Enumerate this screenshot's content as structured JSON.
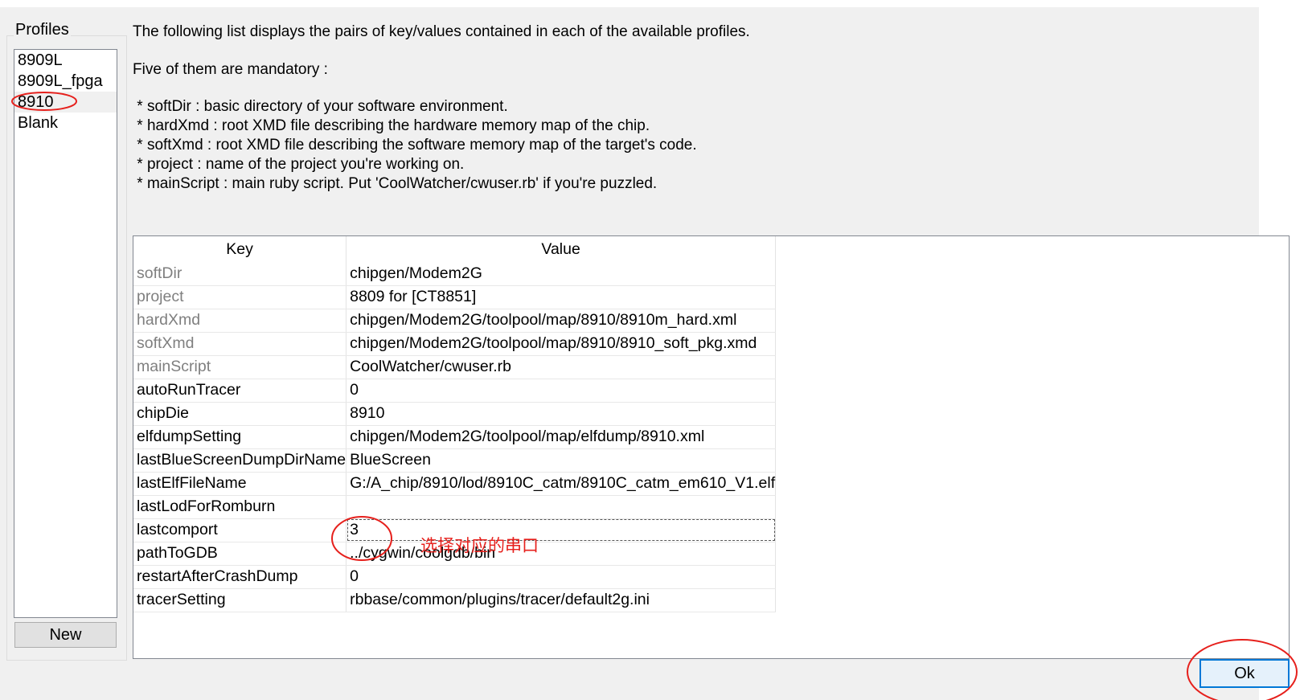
{
  "profiles": {
    "title": "Profiles",
    "items": [
      {
        "label": "8909L"
      },
      {
        "label": "8909L_fpga"
      },
      {
        "label": "8910"
      },
      {
        "label": "Blank"
      }
    ],
    "selected": "8910",
    "new_button": "New"
  },
  "description": {
    "line1": "The following list displays the pairs of key/values contained in each of the available profiles.",
    "line2": "Five of them are mandatory :",
    "bullets": [
      " * softDir : basic directory of your software environment.",
      " * hardXmd : root XMD file describing the hardware memory map of the chip.",
      " * softXmd : root XMD file describing the software memory map of the target's code.",
      " * project : name of the project you're working on.",
      " * mainScript : main ruby script. Put 'CoolWatcher/cwuser.rb' if you're puzzled."
    ]
  },
  "table": {
    "headers": {
      "key": "Key",
      "value": "Value"
    },
    "rows": [
      {
        "key": "softDir",
        "value": "chipgen/Modem2G",
        "mandatory": true
      },
      {
        "key": "project",
        "value": "8809 for [CT8851]",
        "mandatory": true
      },
      {
        "key": "hardXmd",
        "value": "chipgen/Modem2G/toolpool/map/8910/8910m_hard.xml",
        "mandatory": true
      },
      {
        "key": "softXmd",
        "value": "chipgen/Modem2G/toolpool/map/8910/8910_soft_pkg.xmd",
        "mandatory": true
      },
      {
        "key": "mainScript",
        "value": "CoolWatcher/cwuser.rb",
        "mandatory": true
      },
      {
        "key": "autoRunTracer",
        "value": "0"
      },
      {
        "key": "chipDie",
        "value": "8910"
      },
      {
        "key": "elfdumpSetting",
        "value": "chipgen/Modem2G/toolpool/map/elfdump/8910.xml"
      },
      {
        "key": "lastBlueScreenDumpDirName",
        "value": "BlueScreen"
      },
      {
        "key": "lastElfFileName",
        "value": "G:/A_chip/8910/lod/8910C_catm/8910C_catm_em610_V1.elf"
      },
      {
        "key": "lastLodForRomburn",
        "value": ""
      },
      {
        "key": "lastcomport",
        "value": "3",
        "editing": true
      },
      {
        "key": "pathToGDB",
        "value": "../cygwin/coolgdb/bin"
      },
      {
        "key": "restartAfterCrashDump",
        "value": "0"
      },
      {
        "key": "tracerSetting",
        "value": "rbbase/common/plugins/tracer/default2g.ini"
      }
    ]
  },
  "annotation": {
    "text": "选择对应的串口",
    "color": "#e6201c"
  },
  "ok_button": "Ok"
}
